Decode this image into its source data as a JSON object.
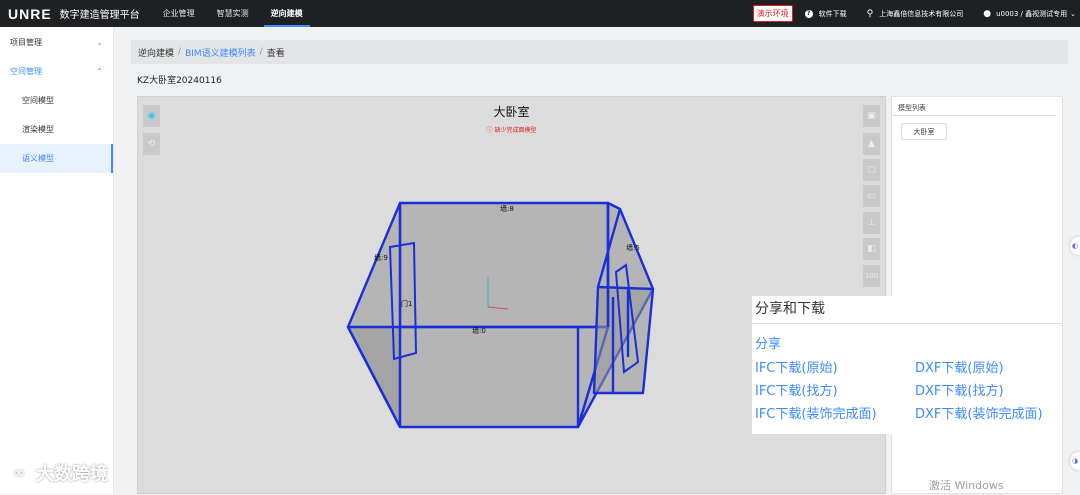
{
  "header": {
    "logo": "UNRE",
    "brand": "数字建造管理平台",
    "nav": [
      "企业管理",
      "智慧实测",
      "逆向建模"
    ],
    "env_badge": "演示环境",
    "download": "软件下载",
    "company": "上海鑫倍信息技术有限公司",
    "user": "u0003 / 鑫视测试专用"
  },
  "sidebar": {
    "items": [
      {
        "label": "项目管理"
      },
      {
        "label": "空间管理"
      },
      {
        "label": "空间模型"
      },
      {
        "label": "渲染模型"
      },
      {
        "label": "语义模型"
      }
    ]
  },
  "breadcrumb": {
    "root": "逆向建模",
    "list": "BIM语义建模列表",
    "current": "查看"
  },
  "model_name": "KZ大卧室20240116",
  "viewer": {
    "title": "大卧室",
    "warning": "缺少完成面模型",
    "labels": {
      "wall8": "墙:8",
      "wall9": "墙:9",
      "wall0": "墙:0",
      "door1": "门1",
      "wall_right": "墙:5"
    }
  },
  "model_list": {
    "title": "模型列表",
    "items": [
      "大卧室"
    ]
  },
  "share": {
    "title": "分享和下载",
    "share": "分享",
    "ifc": [
      "IFC下载(原始)",
      "IFC下载(找方)",
      "IFC下载(装饰完成面)"
    ],
    "dxf": [
      "DXF下载(原始)",
      "DXF下载(找方)",
      "DXF下载(装饰完成面)"
    ]
  },
  "watermark": "大数跨境",
  "activate_text": "激活 Windows",
  "colors": {
    "accent": "#3b8bff",
    "wall_edge": "#1a2fd8",
    "warning": "#e02020"
  }
}
